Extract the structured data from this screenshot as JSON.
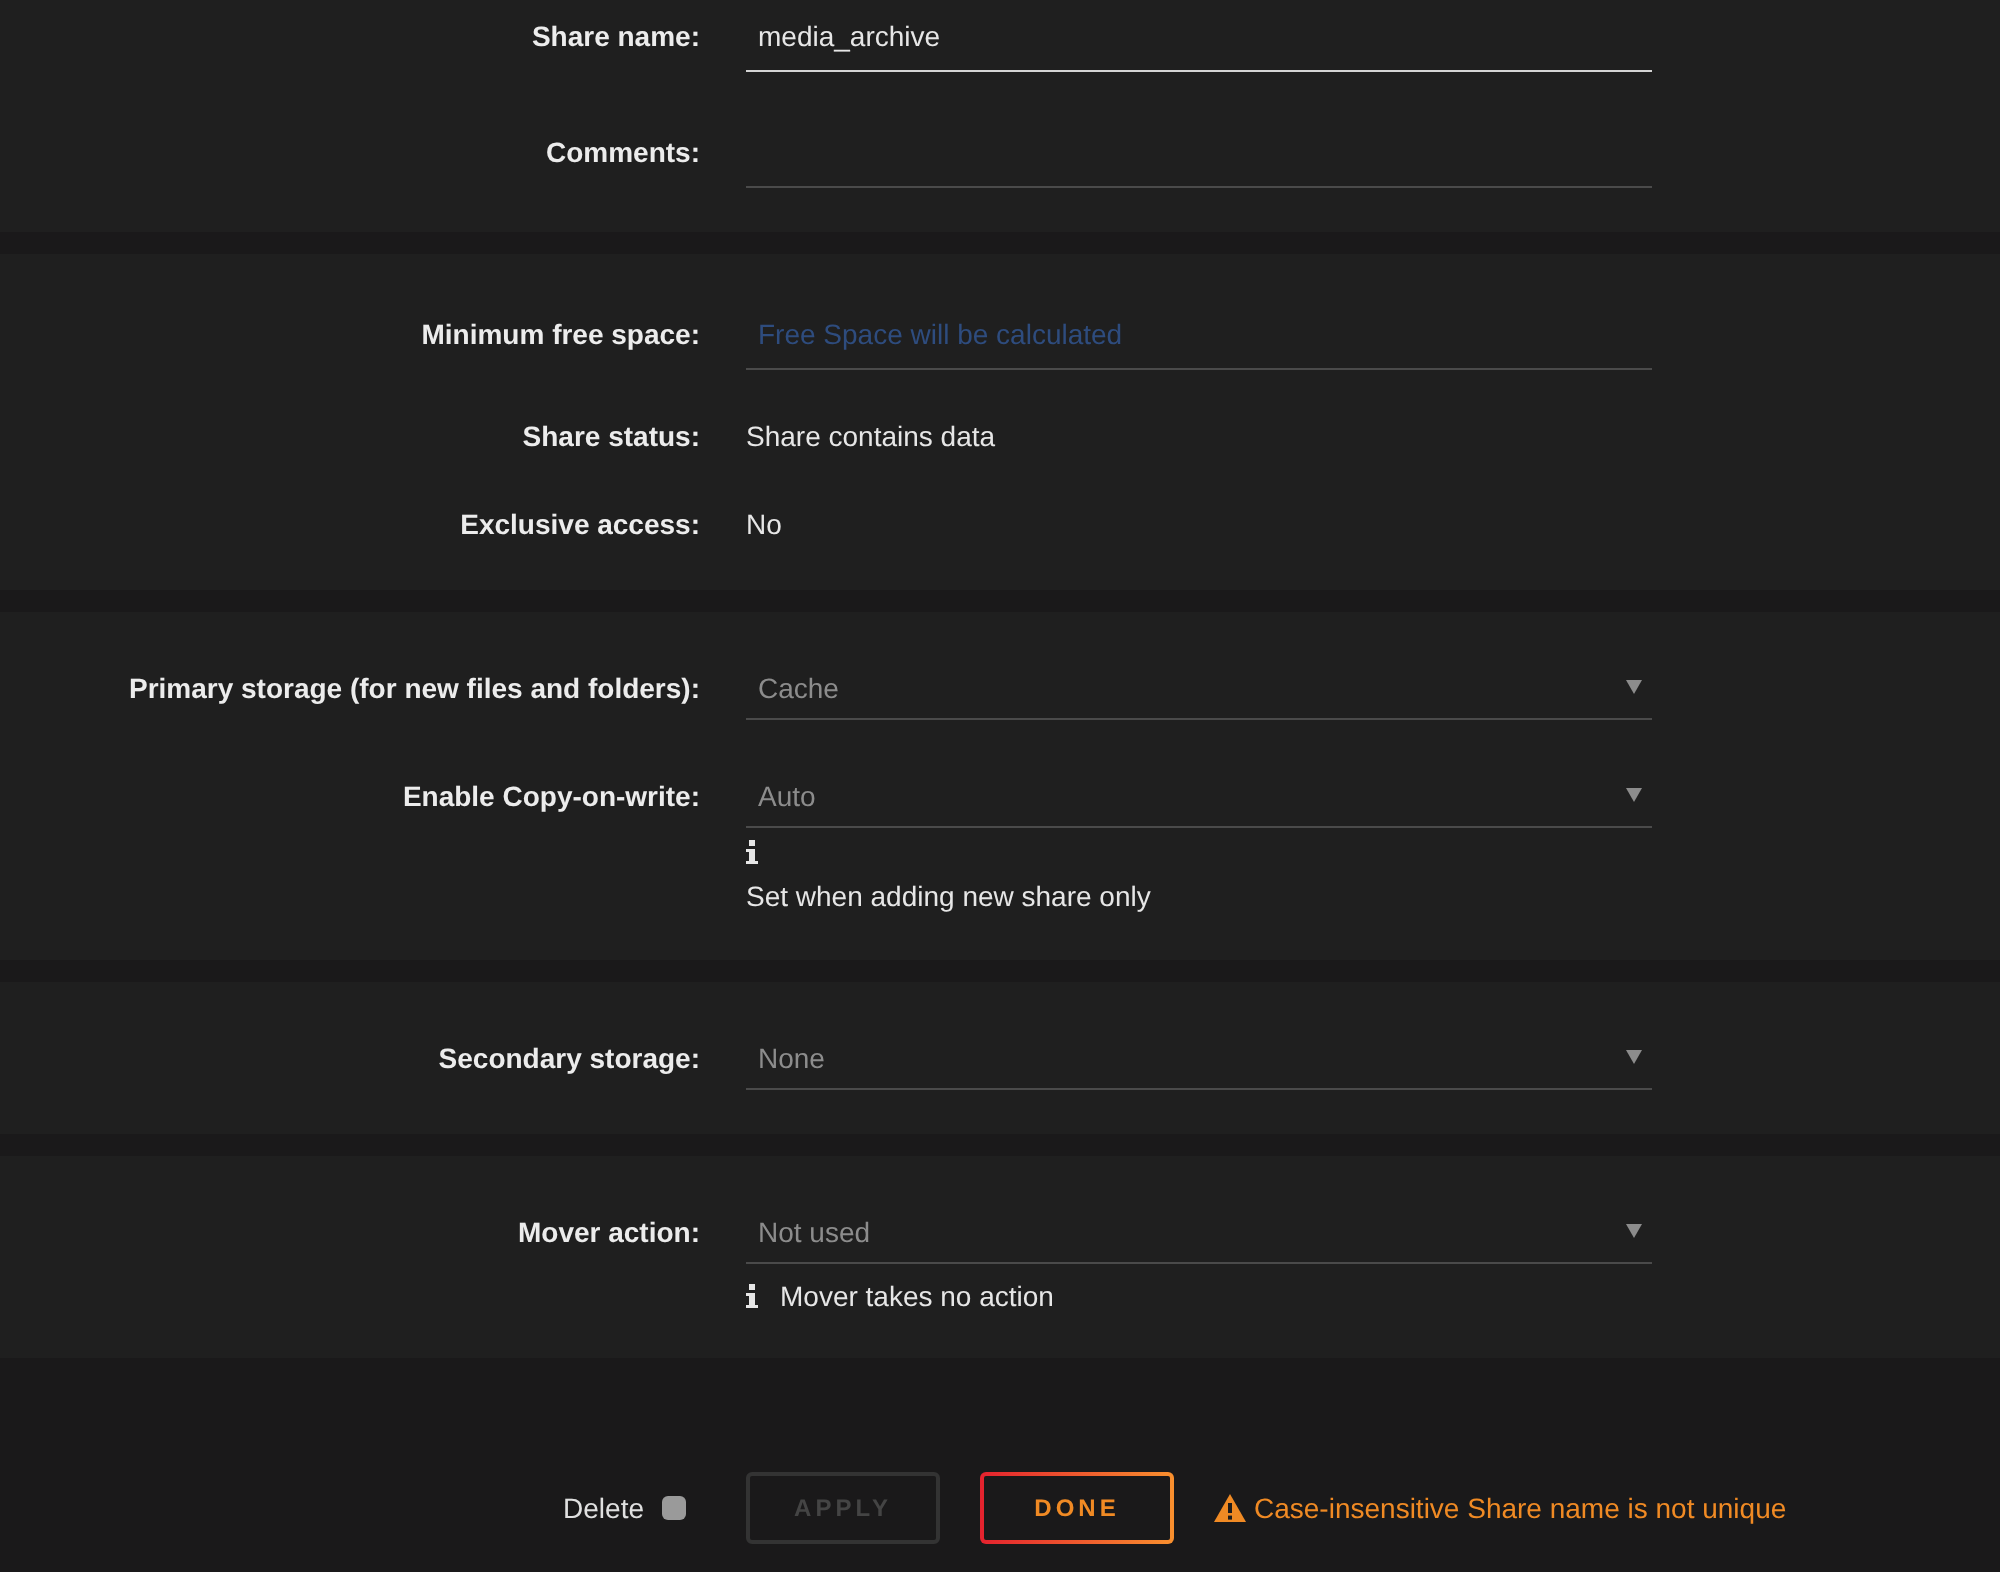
{
  "sections": [
    {
      "rows": [
        {
          "kind": "input",
          "label": "Share name:",
          "value": "media_archive",
          "focused": true
        },
        {
          "kind": "input",
          "label": "Comments:",
          "focused": false
        }
      ]
    },
    {
      "rows": [
        {
          "kind": "input",
          "label": "Minimum free space:",
          "placeholder": "Free Space will be calculated",
          "focused": false
        },
        {
          "kind": "text",
          "label": "Share status:",
          "value": "Share contains data"
        },
        {
          "kind": "text",
          "label": "Exclusive access:",
          "value": "No"
        }
      ]
    },
    {
      "rows": [
        {
          "kind": "select",
          "label": "Primary storage (for new files and folders):",
          "value": "Cache"
        },
        {
          "kind": "select",
          "label": "Enable Copy-on-write:",
          "value": "Auto",
          "note": {
            "kind": "stacked",
            "text": "Set when adding new share only"
          }
        }
      ]
    },
    {
      "rows": [
        {
          "kind": "select",
          "label": "Secondary storage:",
          "value": "None"
        }
      ]
    },
    {
      "rows": [
        {
          "kind": "select",
          "label": "Mover action:",
          "value": "Not used",
          "note": {
            "kind": "inline",
            "text": "Mover takes no action"
          }
        }
      ]
    }
  ],
  "footer": {
    "delete": {
      "label": "Delete",
      "checked": false
    },
    "buttons": [
      {
        "label": "APPLY",
        "disabled": true
      },
      {
        "label": "DONE",
        "disabled": false
      }
    ],
    "warning": "Case-insensitive Share name is not unique"
  }
}
